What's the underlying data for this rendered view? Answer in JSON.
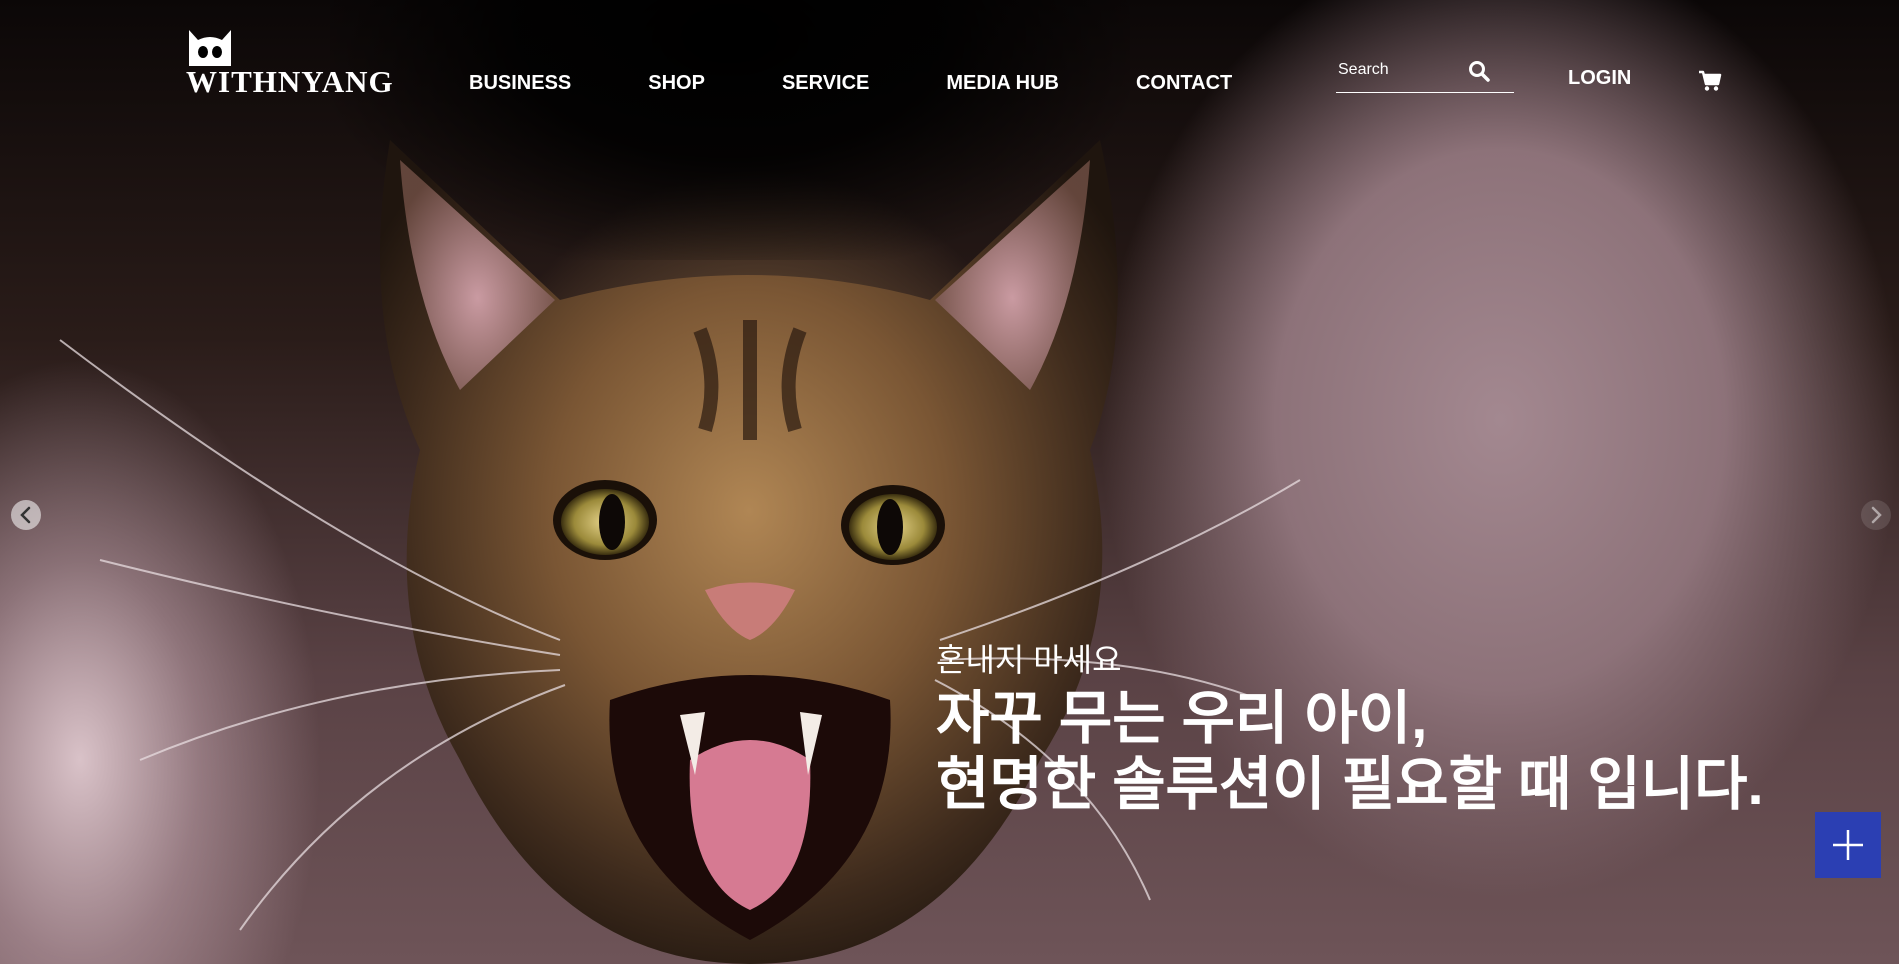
{
  "header": {
    "logo_text": "WITHNYANG",
    "nav": [
      {
        "label": "BUSINESS"
      },
      {
        "label": "SHOP"
      },
      {
        "label": "SERVICE"
      },
      {
        "label": "MEDIA HUB"
      },
      {
        "label": "CONTACT"
      }
    ],
    "search": {
      "placeholder": "Search",
      "value": ""
    },
    "login_label": "LOGIN",
    "icons": {
      "search": "search-icon",
      "cart": "cart-icon"
    }
  },
  "hero": {
    "subtitle": "혼내지 마세요",
    "title_line1": "자꾸 무는 우리 아이,",
    "title_line2": "현명한 솔루션이 필요할 때 입니다.",
    "prev_icon": "chevron-left-icon",
    "next_icon": "chevron-right-icon"
  },
  "fab": {
    "icon": "plus-icon",
    "color": "#2b3fb3"
  }
}
